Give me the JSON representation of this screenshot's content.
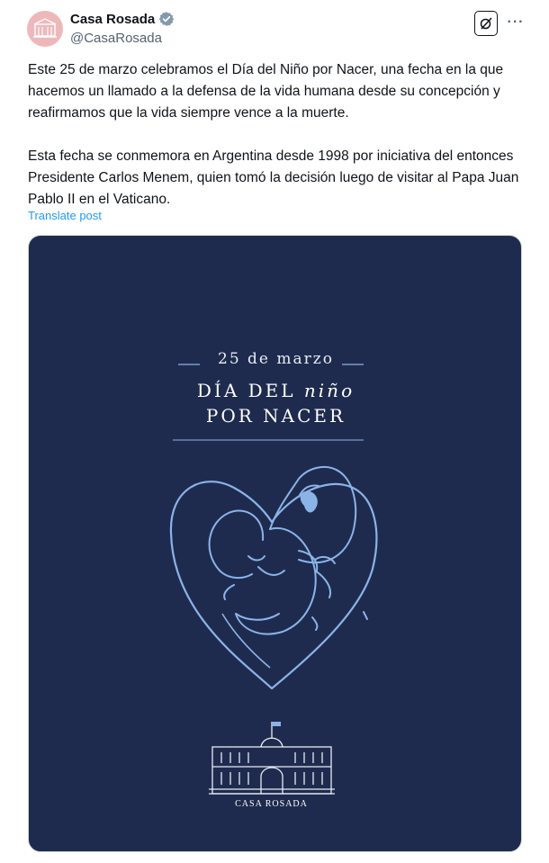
{
  "post": {
    "author_name": "Casa Rosada",
    "author_handle": "@CasaRosada",
    "paragraphs": [
      "Este 25 de marzo celebramos el Día del Niño por Nacer, una fecha en la que hacemos un llamado a la defensa de la vida humana desde su concepción y reafirmamos que la vida siempre vence a la muerte.",
      "Esta fecha se conmemora en Argentina desde 1998 por iniciativa del entonces Presidente Carlos Menem, quien tomó la decisión luego de visitar al Papa Juan Pablo II en el Vaticano."
    ],
    "translate_label": "Translate post",
    "more_label": "···"
  },
  "image": {
    "date_text": "25 de marzo",
    "title_part1": "DÍA DEL ",
    "title_italic": "niño",
    "title_line2": "POR NACER",
    "brand_text": "CASA ROSADA"
  },
  "colors": {
    "accent_link": "#1d9bf0",
    "verified_badge": "#829aab",
    "image_background": "#1f2b4e",
    "image_line": "#8ab4e8"
  },
  "icons": {
    "verified": "verified-badge-icon",
    "grok": "grok-icon",
    "more": "more-icon"
  }
}
